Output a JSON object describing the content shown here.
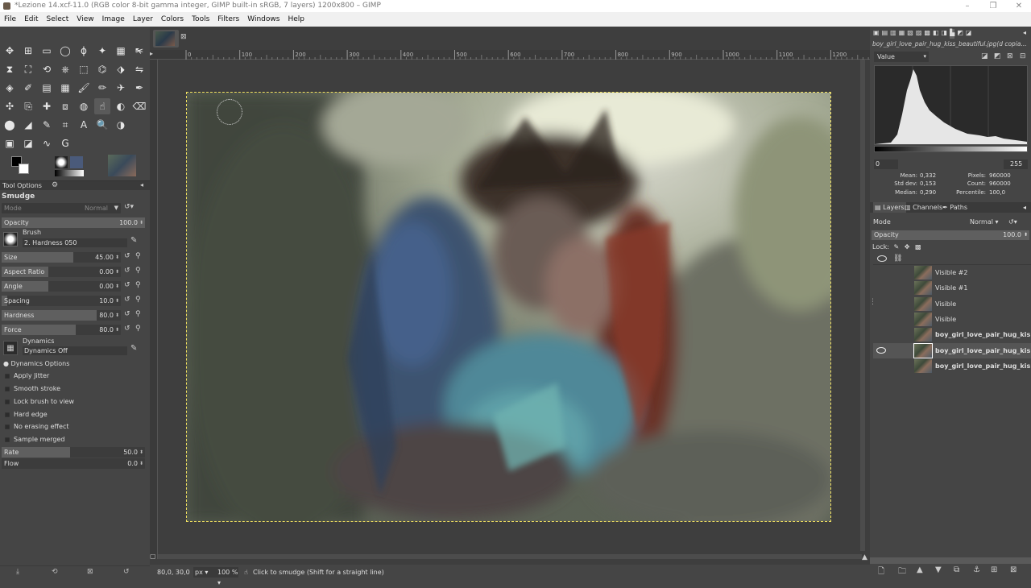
{
  "window": {
    "title": "*Lezione 14.xcf-11.0 (RGB color 8-bit gamma integer, GIMP built-in sRGB, 7 layers) 1200x800 – GIMP",
    "controls": [
      "–",
      "❐",
      "✕"
    ]
  },
  "menu": [
    "File",
    "Edit",
    "Select",
    "View",
    "Image",
    "Layer",
    "Colors",
    "Tools",
    "Filters",
    "Windows",
    "Help"
  ],
  "tool_options": {
    "tab_label": "Tool Options",
    "tool_name": "Smudge",
    "mode_label": "Mode",
    "mode_value": "Normal",
    "opacity": {
      "label": "Opacity",
      "value": "100.0",
      "fraction": 1.0
    },
    "brush_label": "Brush",
    "brush_name": "2. Hardness 050",
    "size": {
      "label": "Size",
      "value": "45.00",
      "fraction": 0.6
    },
    "aspect_ratio": {
      "label": "Aspect Ratio",
      "value": "0.00",
      "fraction": 0.39
    },
    "angle": {
      "label": "Angle",
      "value": "0.00",
      "fraction": 0.39
    },
    "spacing": {
      "label": "Spacing",
      "value": "10.0",
      "fraction": 0.05
    },
    "hardness": {
      "label": "Hardness",
      "value": "80.0",
      "fraction": 0.8
    },
    "force": {
      "label": "Force",
      "value": "80.0",
      "fraction": 0.62
    },
    "dynamics_label": "Dynamics",
    "dynamics_value": "Dynamics Off",
    "dynamics_options": "Dynamics Options",
    "checks": [
      "Apply Jitter",
      "Smooth stroke",
      "Lock brush to view",
      "Hard edge",
      "No erasing effect",
      "Sample merged"
    ],
    "rate": {
      "label": "Rate",
      "value": "50.0",
      "fraction": 0.48
    },
    "flow": {
      "label": "Flow",
      "value": "0.0",
      "fraction": 0.0
    }
  },
  "ruler_labels": [
    "0",
    "100",
    "200",
    "300",
    "400",
    "500",
    "600",
    "700",
    "800",
    "900",
    "1000",
    "1100",
    "1200"
  ],
  "status": {
    "coords": "80,0, 30,0",
    "unit": "px",
    "zoom": "100 %",
    "hint": "Click to smudge (Shift for a straight line)"
  },
  "histogram": {
    "image_name": "boy_girl_love_pair_hug_kiss_beautiful.jpg(d copia...",
    "channel": "Value",
    "range_min": "0",
    "range_max": "255",
    "mean_label": "Mean:",
    "mean": "0,332",
    "std_label": "Std dev:",
    "std": "0,153",
    "median_label": "Median:",
    "median": "0,290",
    "pixels_label": "Pixels:",
    "pixels": "960000",
    "count_label": "Count:",
    "count": "960000",
    "percentile_label": "Percentile:",
    "percentile": "100,0"
  },
  "layers_panel": {
    "tabs": [
      "Layers",
      "Channels",
      "Paths"
    ],
    "mode_label": "Mode",
    "mode_value": "Normal",
    "opacity_label": "Opacity",
    "opacity_value": "100.0",
    "lock_label": "Lock:",
    "layers": [
      {
        "name": "Visible #2",
        "visible": false,
        "bold": false
      },
      {
        "name": "Visible #1",
        "visible": false,
        "bold": false
      },
      {
        "name": "Visible",
        "visible": false,
        "bold": false
      },
      {
        "name": "Visible",
        "visible": false,
        "bold": false
      },
      {
        "name": "boy_girl_love_pair_hug_kiss",
        "visible": false,
        "bold": true
      },
      {
        "name": "boy_girl_love_pair_hug_kiss",
        "visible": true,
        "bold": true
      },
      {
        "name": "boy_girl_love_pair_hug_kiss",
        "visible": false,
        "bold": true
      }
    ]
  },
  "colors": {
    "accent": "#f0e060",
    "dock": "#454545",
    "canvas_bg": "#3e3e3e"
  }
}
